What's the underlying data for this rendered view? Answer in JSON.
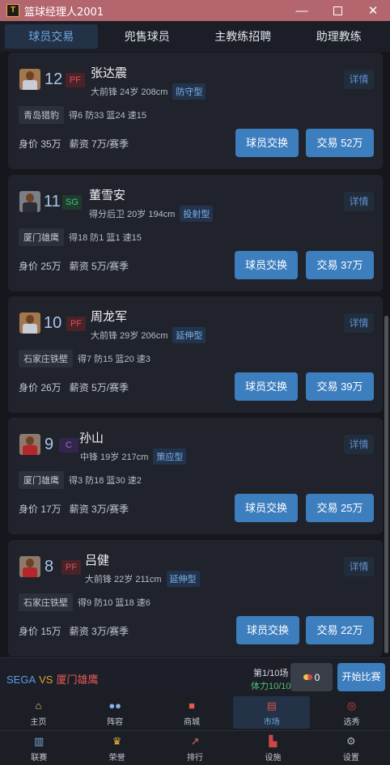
{
  "window": {
    "title": "篮球经理人2001",
    "icon_text": "T",
    "min": "—",
    "close": "✕"
  },
  "tabs": [
    {
      "label": "球员交易"
    },
    {
      "label": "兜售球员"
    },
    {
      "label": "主教练招聘"
    },
    {
      "label": "助理教练"
    }
  ],
  "players": [
    {
      "number": "12",
      "position": "PF",
      "name": "张达震",
      "info": "大前锋 24岁 208cm",
      "type": "防守型",
      "detail": "详情",
      "team": "青岛猎豹",
      "stats": "得6 防33 篮24 速15",
      "value": "身价 35万",
      "salary": "薪资 7万/赛季",
      "swap": "球员交换",
      "trade": "交易 52万"
    },
    {
      "number": "11",
      "position": "SG",
      "name": "董雪安",
      "info": "得分后卫 20岁 194cm",
      "type": "投射型",
      "detail": "详情",
      "team": "厦门雄鹰",
      "stats": "得18 防1 篮1 速15",
      "value": "身价 25万",
      "salary": "薪资 5万/赛季",
      "swap": "球员交换",
      "trade": "交易 37万"
    },
    {
      "number": "10",
      "position": "PF",
      "name": "周龙军",
      "info": "大前锋 29岁 206cm",
      "type": "延伸型",
      "detail": "详情",
      "team": "石家庄铁壁",
      "stats": "得7 防15 篮20 速3",
      "value": "身价 26万",
      "salary": "薪资 5万/赛季",
      "swap": "球员交换",
      "trade": "交易 39万"
    },
    {
      "number": "9",
      "position": "C",
      "name": "孙山",
      "info": "中锋 19岁 217cm",
      "type": "策应型",
      "detail": "详情",
      "team": "厦门雄鹰",
      "stats": "得3 防18 篮30 速2",
      "value": "身价 17万",
      "salary": "薪资 3万/赛季",
      "swap": "球员交换",
      "trade": "交易 25万"
    },
    {
      "number": "8",
      "position": "PF",
      "name": "吕健",
      "info": "大前锋 22岁 211cm",
      "type": "延伸型",
      "detail": "详情",
      "team": "石家庄铁壁",
      "stats": "得9 防10 篮18 速6",
      "value": "身价 15万",
      "salary": "薪资 3万/赛季",
      "swap": "球员交换",
      "trade": "交易 22万"
    }
  ],
  "match": {
    "home": "SEGA",
    "vs": "VS",
    "away": "厦门雄鹰",
    "round": "第1/10场",
    "stamina": "体力10/10",
    "pills": "0",
    "start": "开始比赛"
  },
  "nav_row1": [
    {
      "label": "主页",
      "icon": "home-icon"
    },
    {
      "label": "阵容",
      "icon": "roster-icon"
    },
    {
      "label": "商城",
      "icon": "gift-icon"
    },
    {
      "label": "市场",
      "icon": "market-icon"
    },
    {
      "label": "选秀",
      "icon": "target-icon"
    }
  ],
  "nav_row2": [
    {
      "label": "联赛",
      "icon": "league-chart-icon"
    },
    {
      "label": "荣誉",
      "icon": "trophy-icon"
    },
    {
      "label": "排行",
      "icon": "trend-icon"
    },
    {
      "label": "设施",
      "icon": "facility-icon"
    },
    {
      "label": "设置",
      "icon": "gear-icon"
    }
  ]
}
